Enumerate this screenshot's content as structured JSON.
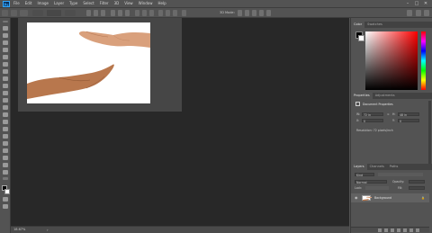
{
  "app": {
    "logo_text": "Ps"
  },
  "menu": {
    "items": [
      "File",
      "Edit",
      "Image",
      "Layer",
      "Type",
      "Select",
      "Filter",
      "3D",
      "View",
      "Window",
      "Help"
    ]
  },
  "window_controls": {
    "minimize": "–",
    "maximize": "□",
    "close": "✕"
  },
  "options_bar": {
    "mode_label": "3D Mode:"
  },
  "status_bar": {
    "zoom": "18.67%",
    "arrow": "›"
  },
  "color_panel": {
    "tabs": [
      "Color",
      "Swatches"
    ]
  },
  "properties_panel": {
    "tabs": [
      "Properties",
      "Adjustments"
    ],
    "title": "Document Properties",
    "w_label": "W:",
    "w_value": "72 in",
    "h_label": "H:",
    "h_value": "48 in",
    "x_label": "X:",
    "x_value": "0",
    "y_label": "Y:",
    "y_value": "0",
    "resolution": "Resolution: 72 pixels/inch"
  },
  "layers_panel": {
    "tabs": [
      "Layers",
      "Channels",
      "Paths"
    ],
    "kind_label": "Kind",
    "blend_mode": "Normal",
    "opacity_label": "Opacity:",
    "lock_label": "Lock:",
    "fill_label": "Fill:",
    "layer_name": "Background"
  },
  "colors": {
    "ui_bg": "#535353",
    "workspace": "#282828",
    "accent": "#31a8ff"
  }
}
